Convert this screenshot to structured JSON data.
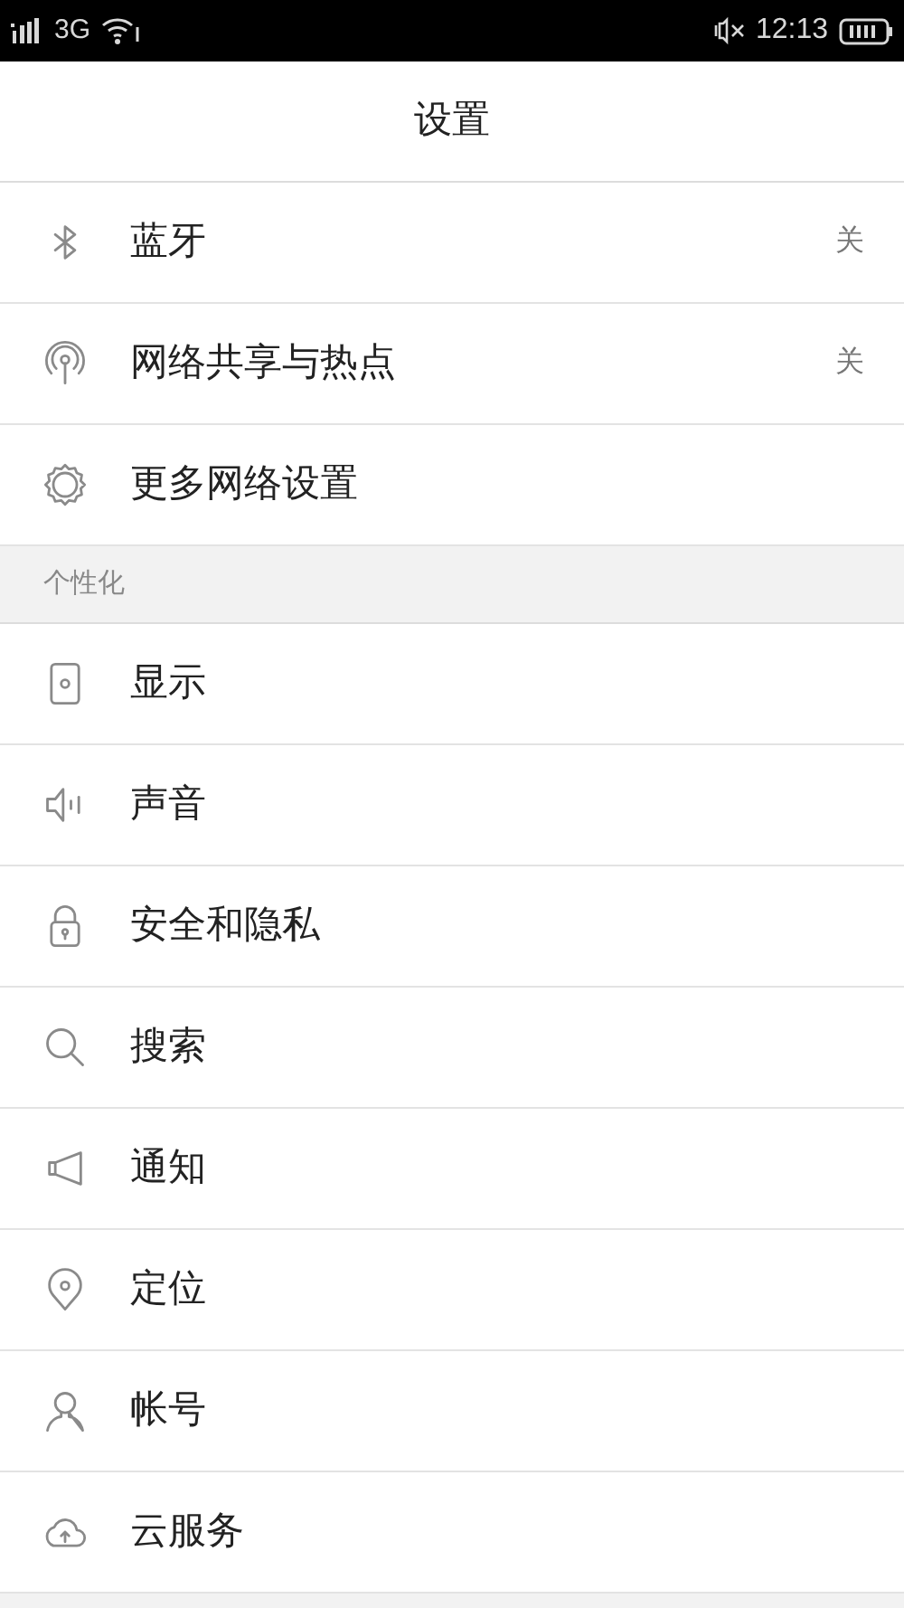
{
  "status_bar": {
    "network": "3G",
    "time": "12:13"
  },
  "header": {
    "title": "设置"
  },
  "sections": [
    {
      "items": [
        {
          "label": "蓝牙",
          "value": "关"
        },
        {
          "label": "网络共享与热点",
          "value": "关"
        },
        {
          "label": "更多网络设置"
        }
      ]
    },
    {
      "title": "个性化",
      "items": [
        {
          "label": "显示"
        },
        {
          "label": "声音"
        },
        {
          "label": "安全和隐私"
        },
        {
          "label": "搜索"
        },
        {
          "label": "通知"
        },
        {
          "label": "定位"
        },
        {
          "label": "帐号"
        },
        {
          "label": "云服务"
        }
      ]
    }
  ]
}
